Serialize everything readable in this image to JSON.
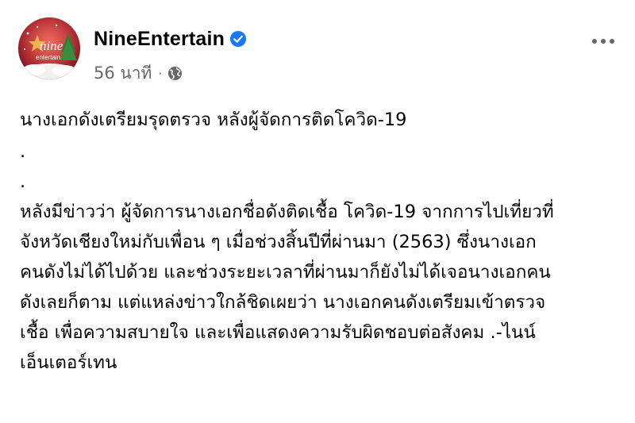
{
  "post": {
    "page_name": "NineEntertain",
    "verified": true,
    "time_ago": "56 นาที",
    "separator": "·",
    "privacy_icon": "globe-icon",
    "more_icon": "more-options-icon",
    "avatar": {
      "logo_text_top": "nine",
      "logo_text_bottom": "entertain"
    },
    "body": {
      "headline": "นางเอกดังเตรียมรุดตรวจ หลังผู้จัดการติดโควิด-19",
      "spacer_1": ".",
      "spacer_2": ".",
      "lines": [
        "หลังมีข่าวว่า ผู้จัดการนางเอกชื่อดังติดเชื้อ โควิด-19 จากการไปเที่ยวที่",
        "จังหวัดเชียงใหม่กับเพื่อน ๆ เมื่อช่วงสิ้นปีที่ผ่านมา (2563) ซึ่งนางเอก",
        "คนดังไม่ได้ไปด้วย และช่วงระยะเวลาที่ผ่านมาก็ยังไม่ได้เจอนางเอกคน",
        "ดังเลยก็ตาม แต่แหล่งข่าวใกล้ชิดเผยว่า นางเอกคนดังเตรียมเข้าตรวจ",
        "เชื้อ เพื่อความสบายใจ และเพื่อแสดงความรับผิดชอบต่อสังคม .-ไนน์",
        "เอ็นเตอร์เทน"
      ]
    }
  },
  "colors": {
    "text": "#050505",
    "secondary_text": "#65676b",
    "verified_blue": "#1877f2",
    "avatar_red": "#a81e2b"
  }
}
